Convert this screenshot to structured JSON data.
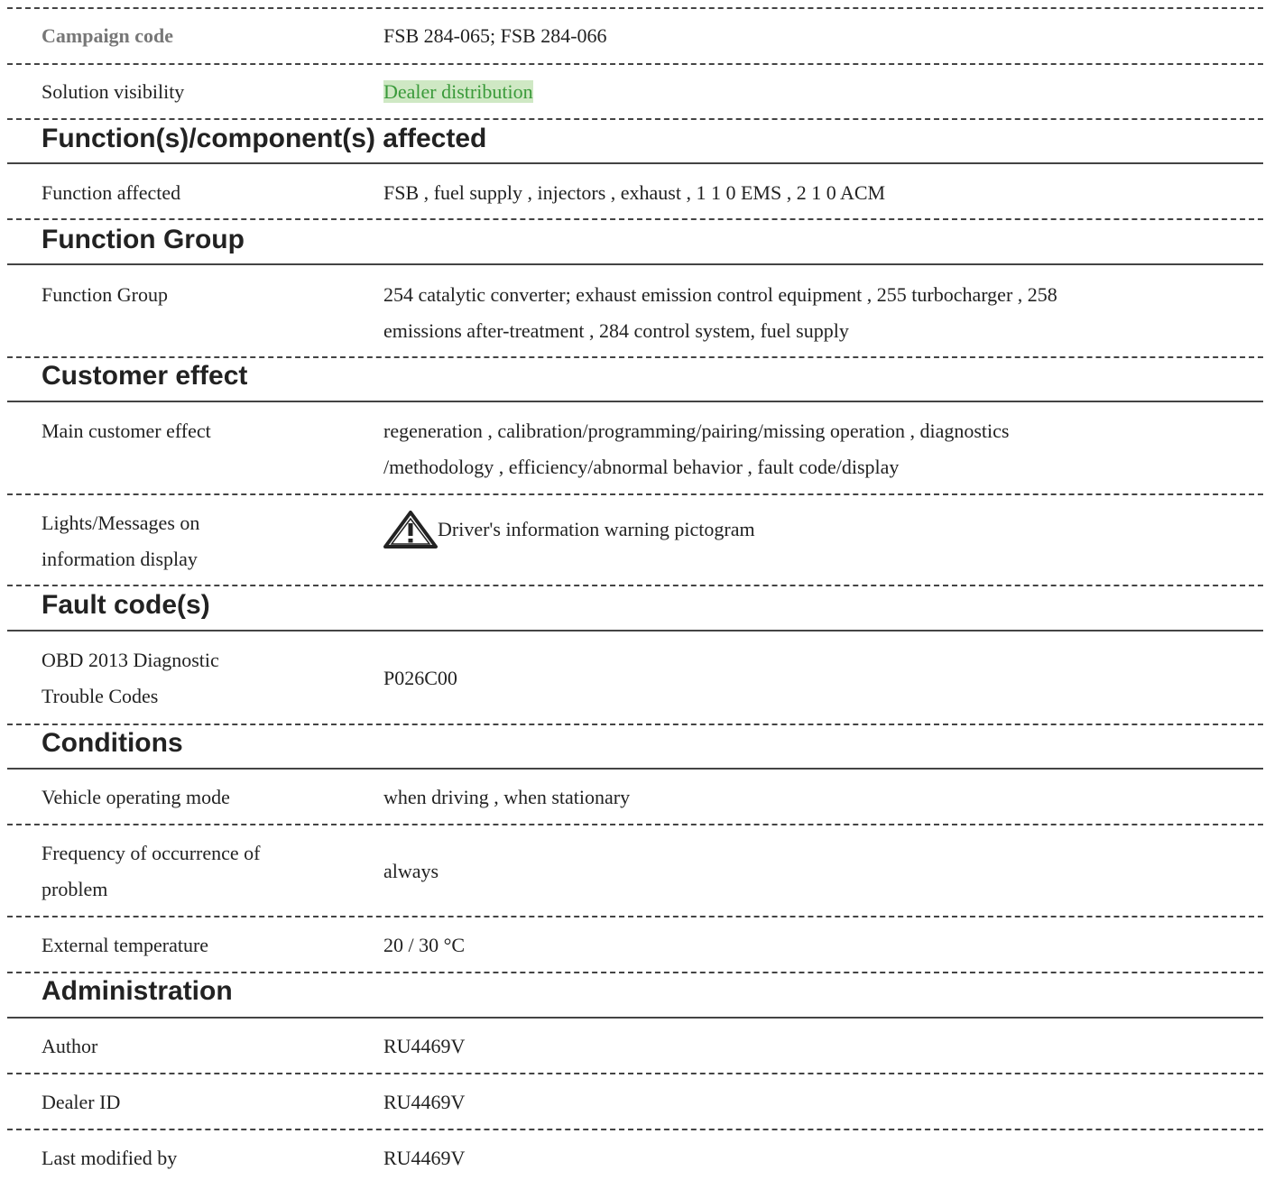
{
  "rows": {
    "campaign_code": {
      "label": "Campaign code",
      "value": "FSB 284-065; FSB 284-066"
    },
    "solution_visibility": {
      "label": "Solution visibility",
      "value": "Dealer distribution",
      "highlight_color": "#cfe8c4",
      "text_color": "#3a9a3a"
    }
  },
  "sections": {
    "function_component": {
      "heading": "Function(s)/component(s) affected",
      "function_affected": {
        "label": "Function affected",
        "value": "FSB   , fuel supply , injectors , exhaust , 1 1 0 EMS , 2 1 0 ACM"
      }
    },
    "function_group": {
      "heading": "Function Group",
      "function_group": {
        "label": "Function Group",
        "value_line1": "254 catalytic converter; exhaust emission control equipment  , 255 turbocharger  , 258",
        "value_line2": "emissions after-treatment  , 284 control system, fuel supply"
      }
    },
    "customer_effect": {
      "heading": "Customer effect",
      "main_customer_effect": {
        "label": "Main customer effect",
        "value_line1": "regeneration , calibration/programming/pairing/missing operation , diagnostics",
        "value_line2": "/methodology , efficiency/abnormal behavior , fault code/display"
      },
      "lights_messages": {
        "label_line1": "Lights/Messages on",
        "label_line2": "information display",
        "icon": "warning-triangle-icon",
        "value": "Driver's information warning pictogram"
      }
    },
    "fault_codes": {
      "heading": "Fault code(s)",
      "obd": {
        "label_line1": "OBD 2013 Diagnostic",
        "label_line2": "Trouble Codes",
        "value": "P026C00"
      }
    },
    "conditions": {
      "heading": "Conditions",
      "vehicle_operating_mode": {
        "label": "Vehicle operating mode",
        "value": "when driving , when stationary"
      },
      "frequency": {
        "label_line1": "Frequency of occurrence of",
        "label_line2": "problem",
        "value": "always"
      },
      "external_temperature": {
        "label": "External temperature",
        "value": "20 / 30 °C"
      }
    },
    "administration": {
      "heading": "Administration",
      "author": {
        "label": "Author",
        "value": "RU4469V"
      },
      "dealer_id": {
        "label": "Dealer ID",
        "value": "RU4469V"
      },
      "last_modified_by": {
        "label": "Last modified by",
        "value": "RU4469V"
      }
    }
  }
}
